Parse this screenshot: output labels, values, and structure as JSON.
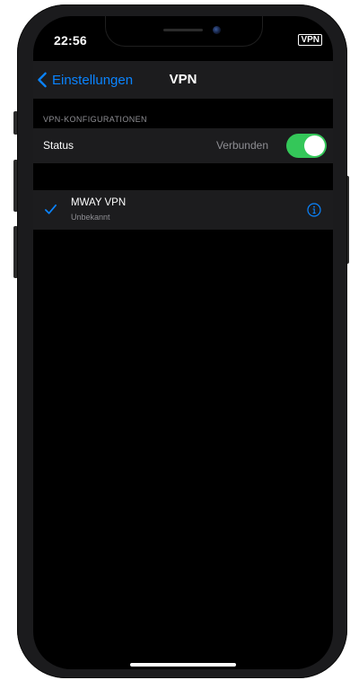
{
  "status_bar": {
    "time": "22:56",
    "vpn_badge": "VPN"
  },
  "navbar": {
    "back_label": "Einstellungen",
    "title": "VPN"
  },
  "section": {
    "header": "VPN-KONFIGURATIONEN"
  },
  "status_row": {
    "label": "Status",
    "value": "Verbunden",
    "toggle_on": true
  },
  "vpn_configs": [
    {
      "name": "MWAY VPN",
      "status": "Unbekannt",
      "selected": true
    }
  ],
  "colors": {
    "accent": "#0a84ff",
    "toggle_on": "#34c759",
    "cell_bg": "#1c1c1e",
    "secondary_text": "#8e8e93"
  },
  "icons": {
    "back": "chevron-left-icon",
    "selected": "checkmark-icon",
    "detail": "info-circle-icon"
  }
}
